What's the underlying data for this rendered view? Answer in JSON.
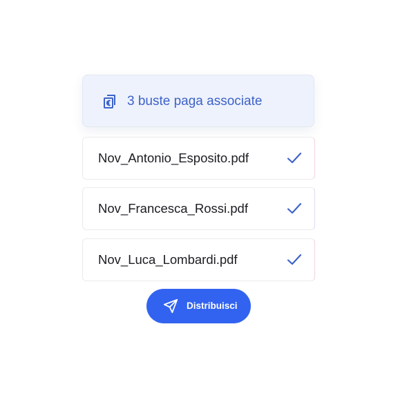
{
  "header": {
    "icon": "euro-document-icon",
    "text": "3 buste paga associate"
  },
  "files": [
    {
      "name": "Nov_Antonio_Esposito.pdf",
      "status_icon": "check-icon"
    },
    {
      "name": "Nov_Francesca_Rossi.pdf",
      "status_icon": "check-icon"
    },
    {
      "name": "Nov_Luca_Lombardi.pdf",
      "status_icon": "check-icon"
    }
  ],
  "action": {
    "label": "Distribuisci",
    "icon": "send-icon"
  },
  "colors": {
    "accent": "#3263f0",
    "header_text": "#3d63c8",
    "header_bg": "#eef2fc",
    "check": "#3d63c8"
  }
}
